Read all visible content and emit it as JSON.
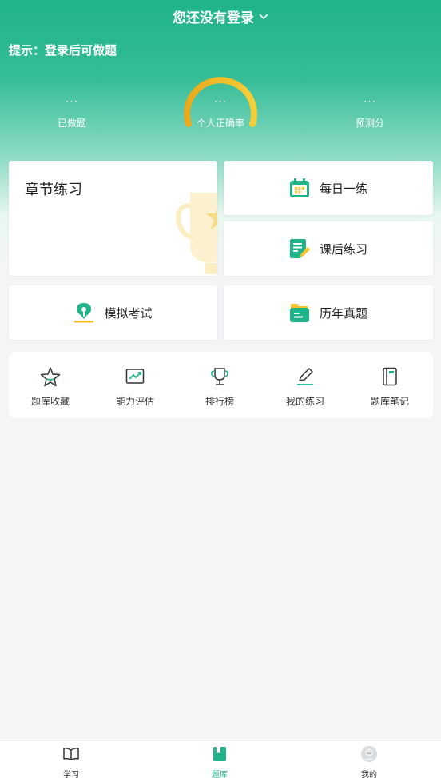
{
  "header": {
    "title": "您还没有登录",
    "chevron_icon": "chevron-down-icon"
  },
  "hint": "提示：登录后可做题",
  "stats": [
    {
      "value": "···",
      "label": "已做题"
    },
    {
      "value": "···",
      "label": "个人正确率"
    },
    {
      "value": "···",
      "label": "预测分"
    }
  ],
  "cards": {
    "chapter": {
      "label": "章节练习",
      "icon": "trophy-watermark-icon"
    },
    "daily": {
      "label": "每日一练",
      "icon": "calendar-icon"
    },
    "after": {
      "label": "课后练习",
      "icon": "notepad-pencil-icon"
    },
    "mock": {
      "label": "模拟考试",
      "icon": "pen-nib-icon"
    },
    "past": {
      "label": "历年真题",
      "icon": "folder-icon"
    }
  },
  "tools": [
    {
      "label": "题库收藏",
      "icon": "star-icon"
    },
    {
      "label": "能力评估",
      "icon": "trend-chart-icon"
    },
    {
      "label": "排行榜",
      "icon": "trophy-icon"
    },
    {
      "label": "我的练习",
      "icon": "edit-pen-icon"
    },
    {
      "label": "题库笔记",
      "icon": "notebook-icon"
    }
  ],
  "tabbar": [
    {
      "label": "学习",
      "icon": "book-open-icon",
      "active": false
    },
    {
      "label": "题库",
      "icon": "bookmark-book-icon",
      "active": true
    },
    {
      "label": "我的",
      "icon": "avatar-icon",
      "active": false
    }
  ],
  "colors": {
    "primary": "#1fb38a",
    "gauge": "#f0b41c",
    "accent_yellow": "#f5c22e"
  }
}
